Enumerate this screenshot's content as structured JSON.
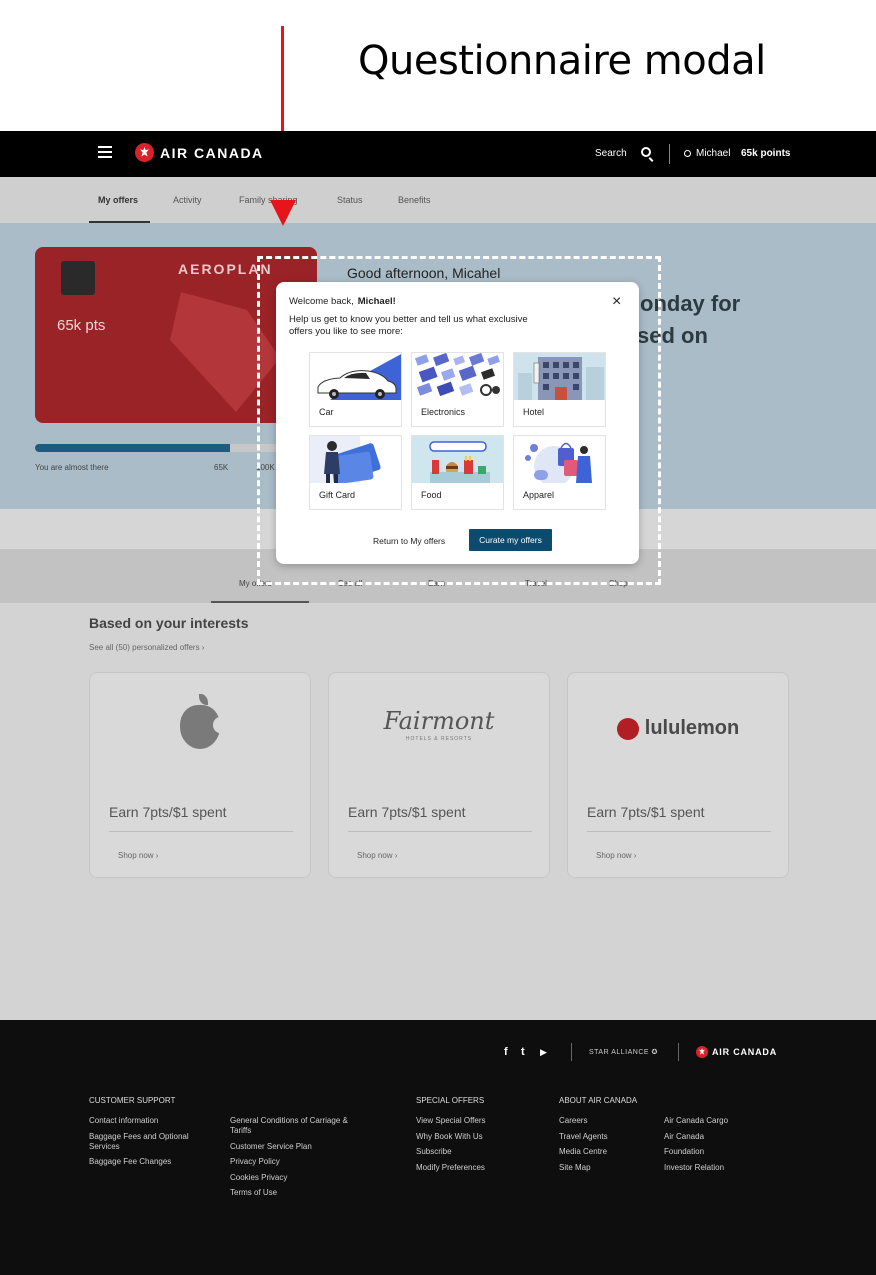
{
  "annotation": {
    "title": "Questionnaire modal"
  },
  "header": {
    "brand": "AIR CANADA",
    "search_label": "Search",
    "user_name": "Michael",
    "points": "65k points"
  },
  "subnav": {
    "tabs": [
      "My offers",
      "Activity",
      "Family sharing",
      "Status",
      "Benefits"
    ]
  },
  "hero": {
    "card_brand": "AEROPLAN",
    "card_points": "65k pts",
    "progress": {
      "fraction": 0.69,
      "label_left": "You are almost there",
      "label_mid": "65K",
      "label_right": "100K"
    },
    "greeting": "Good afternoon, Micahel",
    "line1": "onday for",
    "line2": "sed on"
  },
  "quick_links": [
    "My offers",
    "See all",
    "Earn",
    "Travel",
    "Shop"
  ],
  "interests": {
    "title": "Based on your interests",
    "see_all": "See all (50) personalized offers  ›",
    "offers": [
      {
        "brand_icon": "apple-logo",
        "title": "Earn 7pts/$1 spent",
        "link": "Shop now  ›"
      },
      {
        "brand": "Fairmont",
        "brand_sub": "HOTELS & RESORTS",
        "title": "Earn 7pts/$1 spent",
        "link": "Shop now  ›"
      },
      {
        "brand": "lululemon",
        "title": "Earn 7pts/$1 spent",
        "link": "Shop now  ›"
      }
    ]
  },
  "modal": {
    "welcome": "Welcome back,",
    "name": "Michael!",
    "close_icon": "×",
    "intro": "Help us get to know you better and tell us what exclusive offers you like to see more:",
    "categories": [
      "Car",
      "Electronics",
      "Hotel",
      "Gift Card",
      "Food",
      "Apparel"
    ],
    "return_label": "Return to My offers",
    "curate_label": "Curate my offers",
    "accent": "#0c4a6e"
  },
  "footer": {
    "social_icons": [
      "facebook-icon",
      "twitter-icon",
      "youtube-icon"
    ],
    "social": {
      "facebook": "f",
      "twitter": "t",
      "youtube": "▶"
    },
    "star_alliance": "STAR ALLIANCE ✪",
    "brand": "AIR CANADA",
    "customer_support": {
      "heading": "CUSTOMER SUPPORT",
      "col1": [
        "Contact information",
        "Baggage Fees and Optional Services",
        "Baggage Fee Changes"
      ],
      "col2": [
        "General Conditions of Carriage & Tariffs",
        "Customer Service Plan",
        "Privacy Policy",
        "Cookies Privacy",
        "Terms of Use"
      ]
    },
    "special_offers": {
      "heading": "SPECIAL OFFERS",
      "links": [
        "View Special Offers",
        "Why Book With Us",
        "Subscribe",
        "Modify Preferences"
      ]
    },
    "about": {
      "heading": "ABOUT AIR CANADA",
      "col1": [
        "Careers",
        "Travel Agents",
        "Media Centre",
        "Site Map"
      ],
      "col2": [
        "Air Canada Cargo",
        "Air Canada",
        "Foundation",
        "Investor Relation"
      ]
    }
  },
  "colors": {
    "brand_red": "#d8232a",
    "arrow": "#e8141c",
    "dark": "#000000"
  }
}
